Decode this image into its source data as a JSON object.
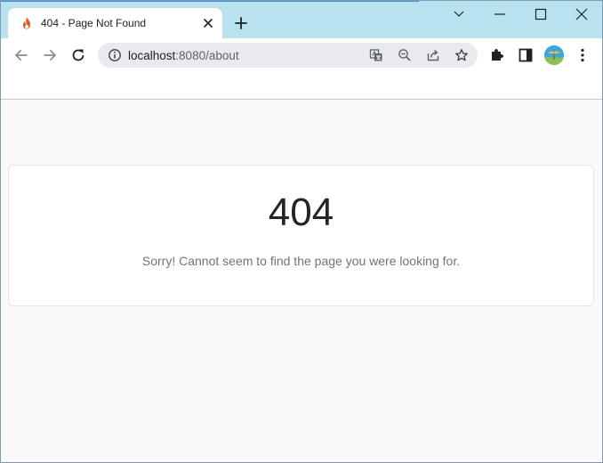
{
  "browser": {
    "tab": {
      "title": "404 - Page Not Found"
    },
    "address": {
      "host": "localhost",
      "path": ":8080/about"
    }
  },
  "page": {
    "error_code": "404",
    "message": "Sorry! Cannot seem to find the page you were looking for."
  },
  "colors": {
    "titlebar": "#b7e2ee",
    "toolbar": "#ffffff",
    "omnibox": "#e8eaed",
    "page_background": "#f9f9f9",
    "card": "#ffffff",
    "code_text": "#212529",
    "message_text": "#6c757d"
  },
  "icons": [
    "fire-icon",
    "close-icon",
    "plus-icon",
    "chevron-down-icon",
    "minimize-icon",
    "maximize-icon",
    "window-close-icon",
    "back-icon",
    "forward-icon",
    "reload-icon",
    "info-icon",
    "translate-icon",
    "zoom-out-icon",
    "share-icon",
    "star-icon",
    "puzzle-icon",
    "sidebar-icon",
    "profile-avatar",
    "kebab-menu-icon"
  ]
}
